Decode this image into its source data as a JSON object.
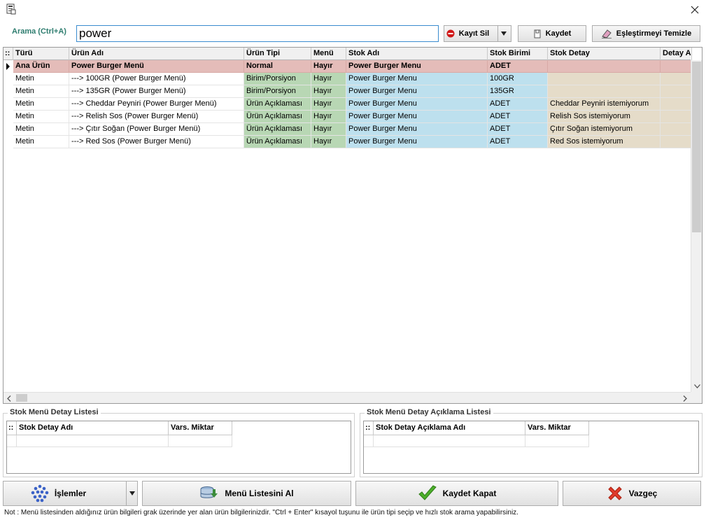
{
  "search": {
    "label": "Arama (Ctrl+A)",
    "value": "power"
  },
  "toolbar": {
    "delete_label": "Kayıt Sil",
    "save_label": "Kaydet",
    "clear_label": "Eşleştirmeyi Temizle"
  },
  "grid": {
    "columns": [
      "Türü",
      "Ürün Adı",
      "Ürün Tipi",
      "Menü",
      "Stok Adı",
      "Stok Birimi",
      "Stok Detay",
      "Detay A"
    ],
    "rows": [
      {
        "type": "Ana Ürün",
        "product": "Power Burger Menü",
        "ptype": "Normal",
        "menu": "Hayır",
        "stock": "Power Burger Menu",
        "unit": "ADET",
        "detail": ""
      },
      {
        "type": "Metin",
        "product": "---> 100GR (Power Burger Menü)",
        "ptype": "Birim/Porsiyon",
        "menu": "Hayır",
        "stock": "Power Burger Menu",
        "unit": "100GR",
        "detail": ""
      },
      {
        "type": "Metin",
        "product": "---> 135GR (Power Burger Menü)",
        "ptype": "Birim/Porsiyon",
        "menu": "Hayır",
        "stock": "Power Burger Menu",
        "unit": "135GR",
        "detail": ""
      },
      {
        "type": "Metin",
        "product": "---> Cheddar Peyniri (Power Burger Menü)",
        "ptype": "Ürün Açıklaması",
        "menu": "Hayır",
        "stock": "Power Burger Menu",
        "unit": "ADET",
        "detail": "Cheddar Peyniri istemiyorum"
      },
      {
        "type": "Metin",
        "product": "---> Relish Sos (Power Burger Menü)",
        "ptype": "Ürün Açıklaması",
        "menu": "Hayır",
        "stock": "Power Burger Menu",
        "unit": "ADET",
        "detail": "Relish Sos istemiyorum"
      },
      {
        "type": "Metin",
        "product": "---> Çıtır Soğan (Power Burger Menü)",
        "ptype": "Ürün Açıklaması",
        "menu": "Hayır",
        "stock": "Power Burger Menu",
        "unit": "ADET",
        "detail": "Çıtır Soğan istemiyorum"
      },
      {
        "type": "Metin",
        "product": "---> Red Sos (Power Burger Menü)",
        "ptype": "Ürün Açıklaması",
        "menu": "Hayır",
        "stock": "Power Burger Menu",
        "unit": "ADET",
        "detail": "Red Sos istemiyorum"
      }
    ]
  },
  "detail_list": {
    "title": "Stok Menü Detay Listesi",
    "columns": [
      "Stok Detay Adı",
      "Vars. Miktar"
    ]
  },
  "desc_list": {
    "title": "Stok Menü Detay Açıklama Listesi",
    "columns": [
      "Stok Detay Açıklama Adı",
      "Vars. Miktar"
    ]
  },
  "actions": {
    "operations_label": "İşlemler",
    "get_menu_label": "Menü Listesini Al",
    "save_close_label": "Kaydet Kapat",
    "cancel_label": "Vazgeç"
  },
  "note": "Not :  Menü listesinden aldığınız ürün bilgileri grak üzerinde yer alan ürün bilgilerinizdir. \"Ctrl + Enter\" kısayol tuşunu ile ürün tipi seçip ve hızlı stok arama yapabilirsiniz.",
  "colors": {
    "main_row": "#e4bcb9",
    "type_cell": "#b8d7b4",
    "stock_cell": "#bde0ee",
    "detail_cell": "#e5dcc9",
    "label_accent": "#2e7d6f"
  }
}
